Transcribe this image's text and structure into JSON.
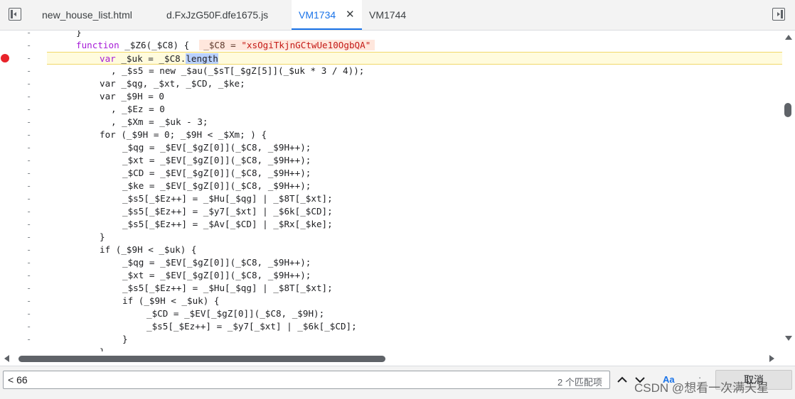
{
  "tabs": [
    {
      "label": "new_house_list.html",
      "active": false
    },
    {
      "label": "d.FxJzG50F.dfe1675.js",
      "active": false
    },
    {
      "label": "VM1734",
      "active": true
    },
    {
      "label": "VM1744",
      "active": false
    }
  ],
  "close_glyph": "✕",
  "gutter_marker": "-",
  "code": {
    "l0": "}",
    "l1_a": "function ",
    "l1_b": "_$Z6(_$C8) {",
    "l1_inline": "_$C8 = ",
    "l1_inline_str": "\"xsOgiTkjnGCtwUe10OgbQA\"",
    "l2_a": "var ",
    "l2_b": "_$uk = _$C8.",
    "l2_sel": "length",
    "l3": ", _$s5 = new _$au(_$sT[_$gZ[5]](_$uk * 3 / 4));",
    "l4": "var _$qg, _$xt, _$CD, _$ke;",
    "l5": "var _$9H = 0",
    "l6": ", _$Ez = 0",
    "l7": ", _$Xm = _$uk - 3;",
    "l8": "for (_$9H = 0; _$9H < _$Xm; ) {",
    "l9": "_$qg = _$EV[_$gZ[0]](_$C8, _$9H++);",
    "l10": "_$xt = _$EV[_$gZ[0]](_$C8, _$9H++);",
    "l11": "_$CD = _$EV[_$gZ[0]](_$C8, _$9H++);",
    "l12": "_$ke = _$EV[_$gZ[0]](_$C8, _$9H++);",
    "l13": "_$s5[_$Ez++] = _$Hu[_$qg] | _$8T[_$xt];",
    "l14": "_$s5[_$Ez++] = _$y7[_$xt] | _$6k[_$CD];",
    "l15": "_$s5[_$Ez++] = _$Av[_$CD] | _$Rx[_$ke];",
    "l16": "}",
    "l17": "if (_$9H < _$uk) {",
    "l18": "_$qg = _$EV[_$gZ[0]](_$C8, _$9H++);",
    "l19": "_$xt = _$EV[_$gZ[0]](_$C8, _$9H++);",
    "l20": "_$s5[_$Ez++] = _$Hu[_$qg] | _$8T[_$xt];",
    "l21": "if (_$9H < _$uk) {",
    "l22": "_$CD = _$EV[_$gZ[0]](_$C8, _$9H);",
    "l23": "_$s5[_$Ez++] = _$y7[_$xt] | _$6k[_$CD];",
    "l24": "}",
    "l25": "}"
  },
  "find": {
    "value": "< 66",
    "match_count": "2 个匹配项",
    "case_label": "Aa",
    "more_label": "·",
    "cancel_label": "取消"
  },
  "watermark": "CSDN @想看一次满天星",
  "colors": {
    "accent": "#1a73e8",
    "breakpoint": "#e8232a",
    "exec_line": "#fffbdd"
  }
}
